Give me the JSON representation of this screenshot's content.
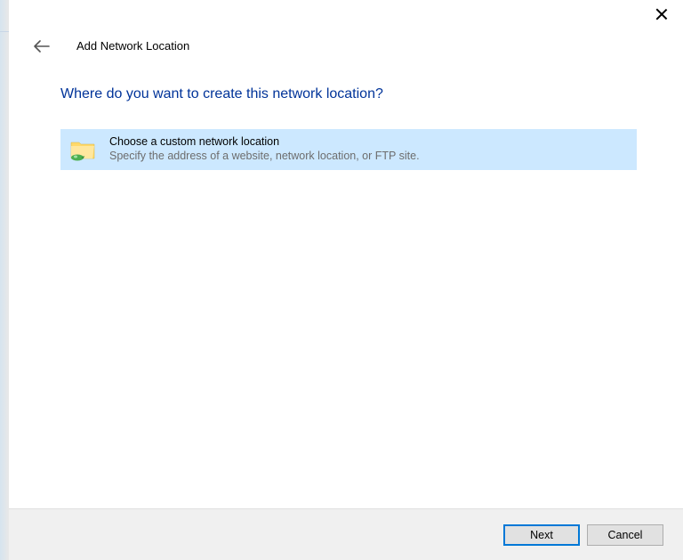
{
  "wizard": {
    "title": "Add Network Location",
    "heading": "Where do you want to create this network location?"
  },
  "option": {
    "title": "Choose a custom network location",
    "subtitle": "Specify the address of a website, network location, or FTP site."
  },
  "buttons": {
    "next": "Next",
    "cancel": "Cancel"
  }
}
